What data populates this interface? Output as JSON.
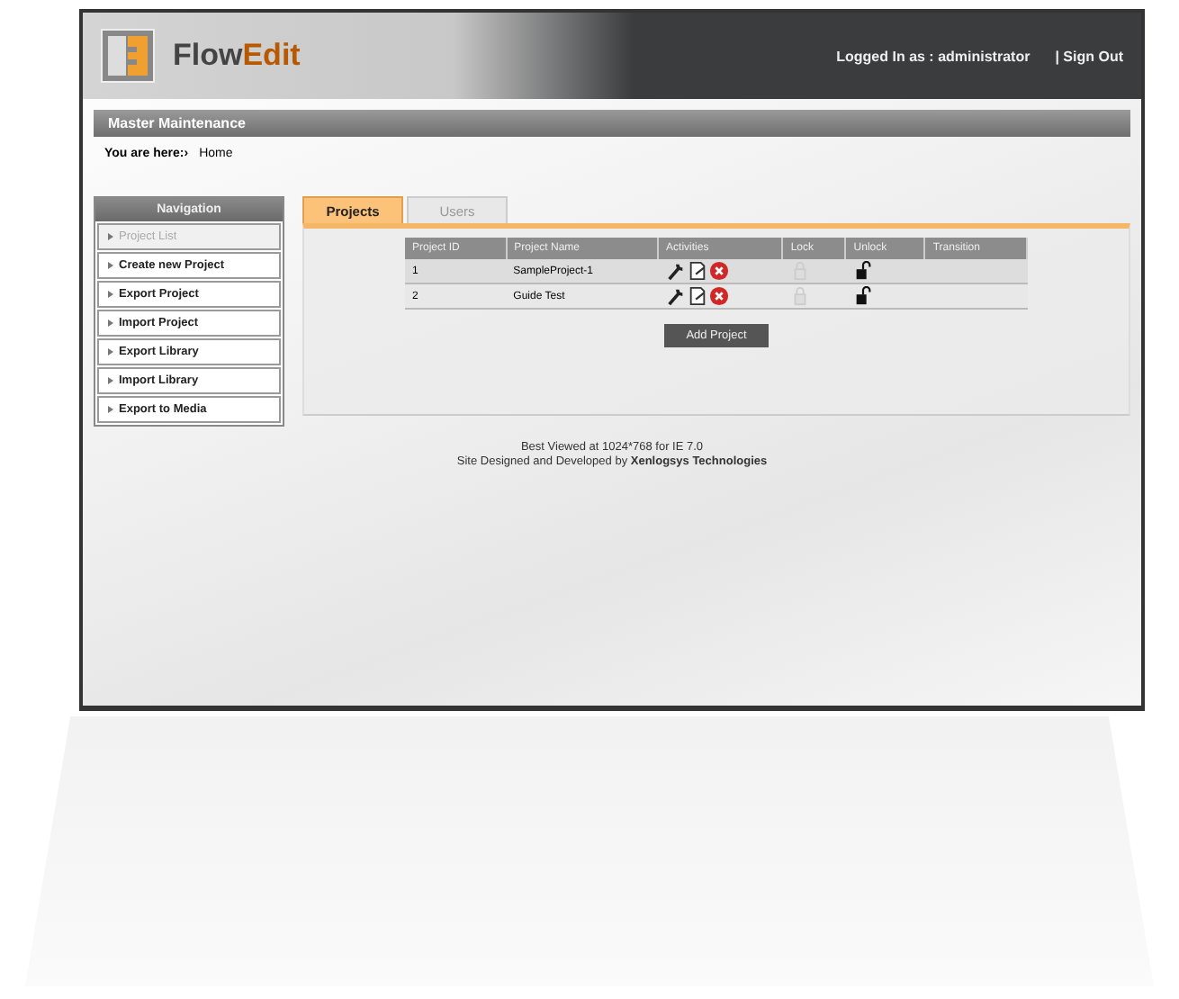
{
  "header": {
    "logo_text": "Flow",
    "logo_accent": "Edit",
    "user_label": "Logged In as : administrator",
    "sign_out": "| Sign Out"
  },
  "section_title": "Master Maintenance",
  "breadcrumb": {
    "label": "You are here:›",
    "current": "Home"
  },
  "navigation": {
    "title": "Navigation",
    "items": [
      {
        "label": "Project List",
        "selected": true
      },
      {
        "label": "Create new Project",
        "selected": false
      },
      {
        "label": "Export Project",
        "selected": false
      },
      {
        "label": "Import Project",
        "selected": false
      },
      {
        "label": "Export Library",
        "selected": false
      },
      {
        "label": "Import Library",
        "selected": false
      },
      {
        "label": "Export to Media",
        "selected": false
      }
    ]
  },
  "tabs": [
    {
      "label": "Projects",
      "selected": true
    },
    {
      "label": "Users",
      "selected": false
    }
  ],
  "table": {
    "columns": [
      "Project ID",
      "Project Name",
      "Activities",
      "Lock",
      "Unlock",
      "Transition"
    ],
    "rows": [
      {
        "id": "1",
        "name": "SampleProject-1"
      },
      {
        "id": "2",
        "name": "Guide Test"
      }
    ]
  },
  "add_button": "Add Project",
  "footer": {
    "line1": "Best Viewed at 1024*768 for IE 7.0",
    "line2_prefix": "Site Designed and Developed by ",
    "line2_company": "Xenlogsys Technologies"
  }
}
